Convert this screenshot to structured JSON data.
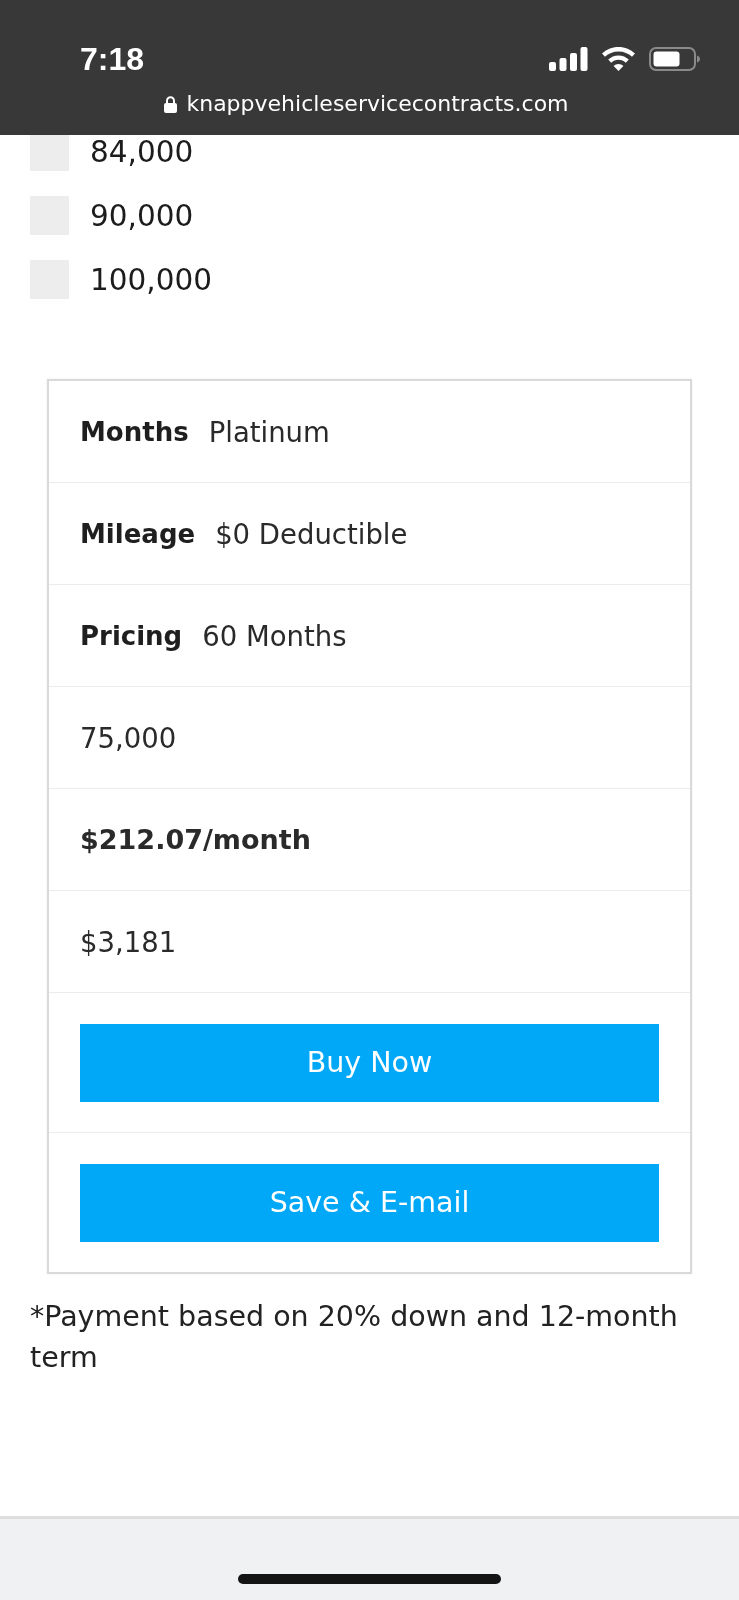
{
  "status_bar": {
    "time": "7:18"
  },
  "address_bar": {
    "url": "knappvehicleservicecontracts.com"
  },
  "mileage_options": [
    {
      "label": "84,000",
      "checked": false
    },
    {
      "label": "90,000",
      "checked": false
    },
    {
      "label": "100,000",
      "checked": false
    }
  ],
  "plan_table": {
    "rows": [
      {
        "kind": "pair",
        "label": "Months",
        "value": "Platinum"
      },
      {
        "kind": "pair",
        "label": "Mileage",
        "value": "$0 Deductible"
      },
      {
        "kind": "pair",
        "label": "Pricing",
        "value": "60 Months"
      },
      {
        "kind": "text",
        "value": "75,000"
      },
      {
        "kind": "price",
        "value": "$212.07/month"
      },
      {
        "kind": "text",
        "value": "$3,181"
      },
      {
        "kind": "button",
        "label": "Buy Now"
      },
      {
        "kind": "button",
        "label": "Save & E-mail"
      }
    ]
  },
  "footnote": "*Payment based on 20% down and 12-month term"
}
